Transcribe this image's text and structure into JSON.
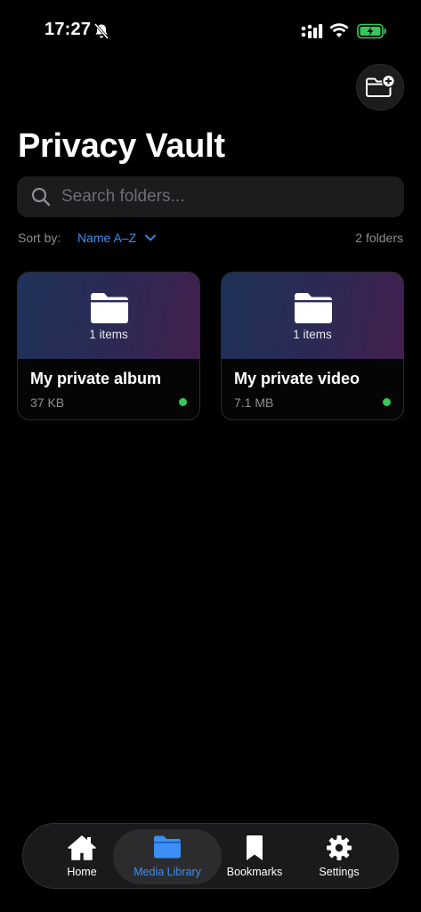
{
  "status_bar": {
    "time": "17:27",
    "icons": [
      "bell-off-icon",
      "signal-icon",
      "wifi-icon",
      "battery-charging-icon"
    ],
    "battery_color": "#34c759"
  },
  "header": {
    "add_folder_icon": "folder-plus-icon",
    "title": "Privacy Vault"
  },
  "search": {
    "placeholder": "Search folders...",
    "value": ""
  },
  "sort": {
    "label": "Sort by:",
    "value": "Name A–Z",
    "count": "2 folders"
  },
  "folders": [
    {
      "name": "My private album",
      "items": "1 items",
      "size": "37 KB",
      "status_color": "#34c759"
    },
    {
      "name": "My private video",
      "items": "1 items",
      "size": "7.1 MB",
      "status_color": "#34c759"
    }
  ],
  "tab_bar": {
    "active": "Media Library",
    "accent": "#3b8ff5",
    "tabs": [
      {
        "label": "Home",
        "icon": "home-icon"
      },
      {
        "label": "Media Library",
        "icon": "folder-icon"
      },
      {
        "label": "Bookmarks",
        "icon": "bookmark-icon"
      },
      {
        "label": "Settings",
        "icon": "gear-icon"
      }
    ]
  }
}
